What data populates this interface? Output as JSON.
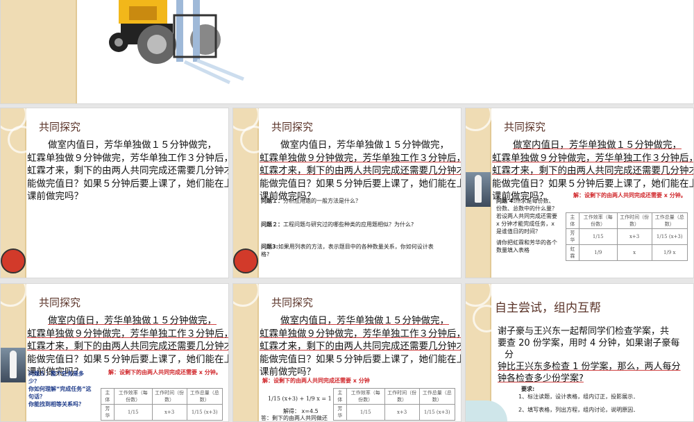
{
  "problem_lines": [
    "做室内值日，芳华单独做１５分钟做完，",
    "虹霖单独做９分钟做完，芳华单独工作３分钟后，",
    "虹霖才来，剩下的由两人共同完成还需要几分钟才",
    "能做完值日？如果５分钟后要上课了，她们能在上",
    "课前做完吗？"
  ],
  "title": "共同探究",
  "s2": {
    "q1": "问题１：",
    "q1t": "分析应用题的一般方法是什么？",
    "q2": "问题２：",
    "q2t": "工程问题与研究过的哪些种类的应用题相似？为什么?",
    "q3": "问题3:",
    "q3t": "如果用列表的方法，表示题目中的各种数量关系，你如何设计表格?"
  },
  "s3": {
    "solution": "解：设剩下的由两人共同完成还需要 x 分钟。",
    "q4": "问题 4:",
    "q4t": "所求是每份数、份数、总数中的什么量？若设两人共同完成还需要 x 分钟才能完成任务，x 是谁值日的时间？",
    "fill": "请你把虹霖和芳华的各个数量填入表格"
  },
  "table": {
    "headers": [
      "主体",
      "工作效率（每份数）",
      "工作时间（份数）",
      "工作总量（总数）"
    ],
    "rows": [
      [
        "芳华",
        "1/15",
        "x+3",
        "1/15 (x+3)"
      ],
      [
        "虹霖",
        "1/9",
        "x",
        "1/9 x"
      ]
    ]
  },
  "s4": {
    "solution": "解：设剩下的由两人共同完成还需要 x 分钟。",
    "q5": "问题５：整个任务是多少？",
    "q5b": "你如何理解“完成任务”这句话？",
    "q5c": "你能找到相等关系吗？"
  },
  "s5": {
    "solution": "解：设剩下的由两人共同完成还需要 x 分钟",
    "equation": "1/15 (x+3) + 1/9 x = 1",
    "result": "解得： x=4.5",
    "answer": "答：剩下的由两人共同做还"
  },
  "s6": {
    "title": "自主尝试，组内互帮",
    "lines": [
      "谢子豪与王兴东一起帮同学们检查学案，共",
      "要查 20 份学案，用时 4 分钟，如果谢子豪每",
      "分",
      "钟比王兴东多检查 1 份学案，那么，两人每分",
      "钟各检查多少份学案?"
    ],
    "req": "要求:",
    "r1": "1、标注读题，设计表格，组内订正，投影展示．",
    "r2": "2、填写表格，列出方程，组内讨论，说明原因．"
  },
  "colors": {
    "strip": "#efdcb4",
    "title": "#5a3328",
    "red": "#d0262a",
    "blue": "#1f3c8a"
  }
}
